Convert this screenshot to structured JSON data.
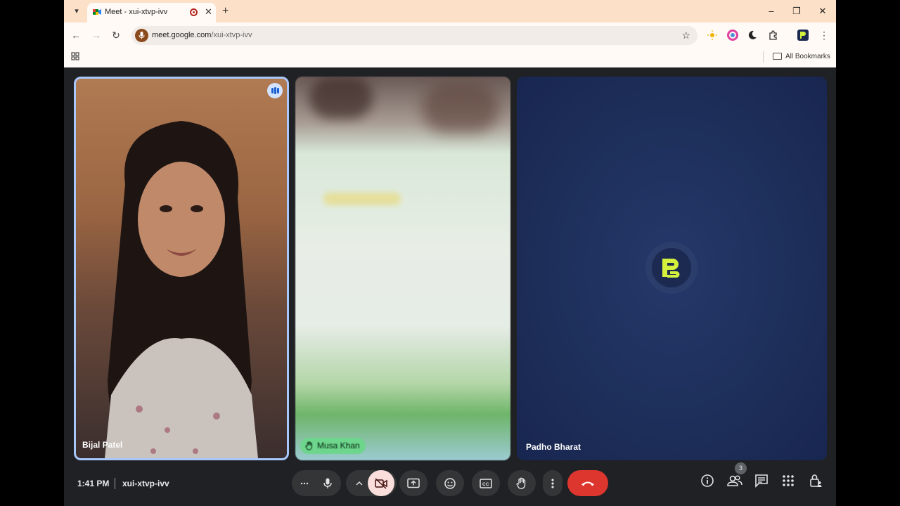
{
  "browser": {
    "tab_title": "Meet - xui-xtvp-ivv",
    "url_host": "meet.google.com",
    "url_path": "/xui-xtvp-ivv",
    "bookmarks_label": "All Bookmarks",
    "icons": [
      "tab-search-icon",
      "meet-favicon",
      "recording-icon",
      "close-icon",
      "new-tab-icon",
      "minimize-icon",
      "restore-icon",
      "close-window-icon",
      "back-icon",
      "forward-icon",
      "reload-icon",
      "microphone-icon",
      "star-icon",
      "extensions-icon",
      "menu-icon",
      "apps-icon",
      "folder-icon"
    ]
  },
  "meeting": {
    "time": "1:41 PM",
    "code": "xui-xtvp-ivv",
    "participants_count": "3",
    "tiles": [
      {
        "name": "Bijal Patel",
        "speaking": true
      },
      {
        "name": "Musa Khan",
        "hand_raised": true
      },
      {
        "name": "Padho Bharat",
        "avatar": "PB logo"
      }
    ]
  },
  "colors": {
    "active_border": "#a8c7fa",
    "hand_chip": "#6dd58c",
    "end_call": "#dc362e",
    "tab_strip": "#fde0c8",
    "pb_yellow": "#d4f03c"
  }
}
